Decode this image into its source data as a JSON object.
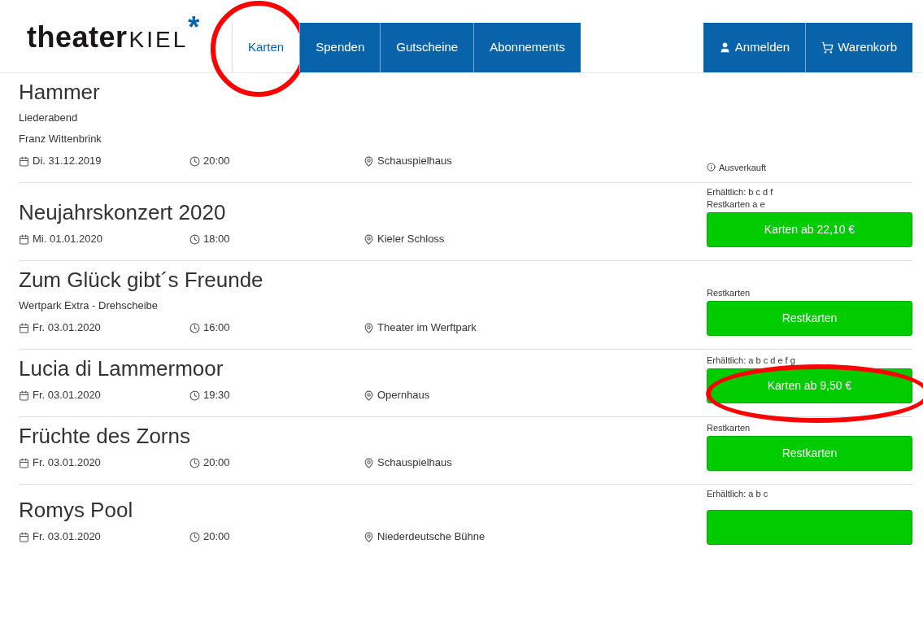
{
  "logo": {
    "word": "theater",
    "city": "KIEL",
    "mark": "*"
  },
  "nav": [
    {
      "label": "Karten",
      "selected": true,
      "circled": true
    },
    {
      "label": "Spenden",
      "selected": false,
      "circled": false
    },
    {
      "label": "Gutscheine",
      "selected": false,
      "circled": false
    },
    {
      "label": "Abonnements",
      "selected": false,
      "circled": false
    }
  ],
  "account": [
    {
      "kind": "user",
      "label": "Anmelden"
    },
    {
      "kind": "cart",
      "label": "Warenkorb"
    }
  ],
  "events": [
    {
      "title": "Hammer",
      "subtitles": [
        "Liederabend",
        "Franz Wittenbrink"
      ],
      "date": "Di. 31.12.2019",
      "time": "20:00",
      "venue": "Schauspielhaus",
      "status": {
        "kind": "soldout",
        "text": "Ausverkauft"
      },
      "circled": false
    },
    {
      "title": "Neujahrskonzert 2020",
      "date": "Mi. 01.01.2020",
      "time": "18:00",
      "venue": "Kieler Schloss",
      "availability": [
        "Erhältlich: b c d f",
        "Restkarten a e"
      ],
      "button": "Karten ab 22,10 €",
      "circled": false
    },
    {
      "title": "Zum Glück gibt´s Freunde",
      "subtitles": [
        "Wertpark Extra - Drehscheibe"
      ],
      "date": "Fr. 03.01.2020",
      "time": "16:00",
      "venue": "Theater im Werftpark",
      "availability": [
        "Restkarten"
      ],
      "button": "Restkarten",
      "circled": false
    },
    {
      "title": "Lucia di Lammermoor",
      "date": "Fr. 03.01.2020",
      "time": "19:30",
      "venue": "Opernhaus",
      "availability": [
        "Erhältlich: a b c d e f g"
      ],
      "button": "Karten ab 9,50 €",
      "circled": true
    },
    {
      "title": "Früchte des Zorns",
      "date": "Fr. 03.01.2020",
      "time": "20:00",
      "venue": "Schauspielhaus",
      "availability": [
        "Restkarten"
      ],
      "button": "Restkarten",
      "circled": false
    },
    {
      "title": "Romys Pool",
      "date": "Fr. 03.01.2020",
      "time": "20:00",
      "venue": "Niederdeutsche Bühne",
      "availability": [
        "Erhältlich: a b c"
      ],
      "button_cut": true,
      "circled": false
    }
  ]
}
